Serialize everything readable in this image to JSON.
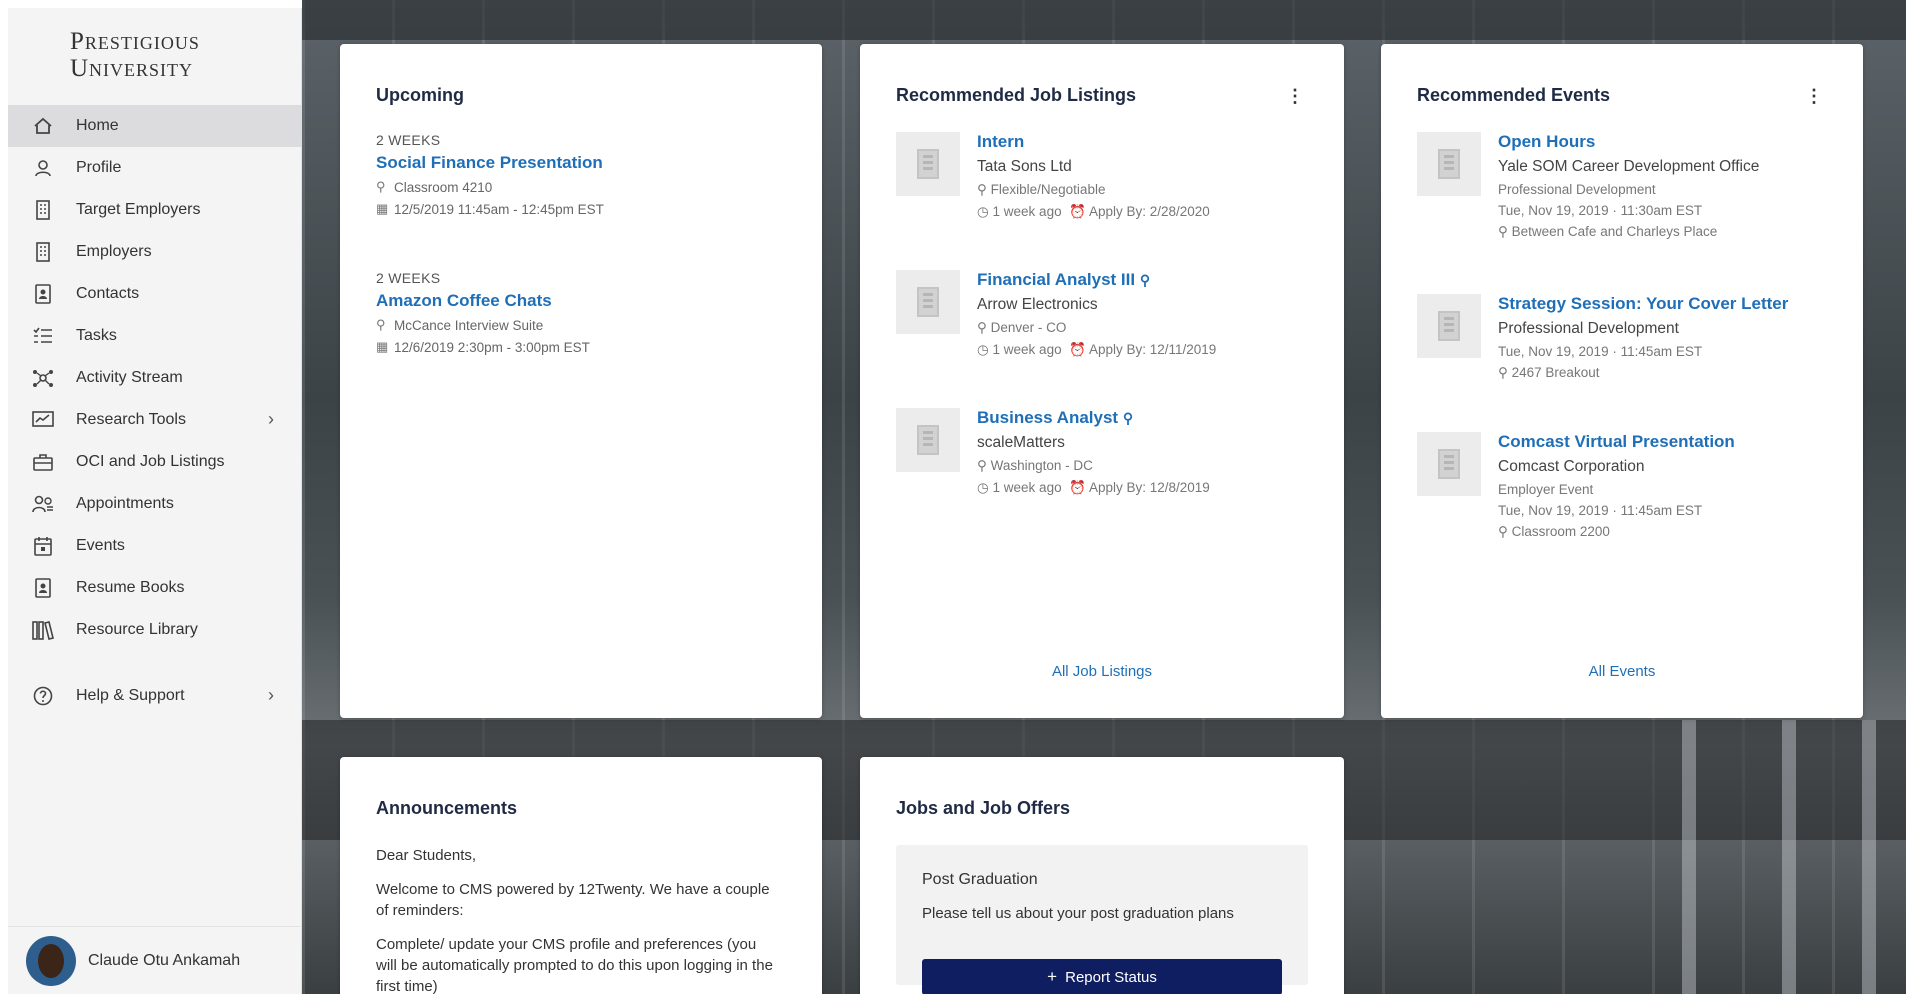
{
  "brand": {
    "logo_line1": "Prestigious",
    "logo_line2": "University"
  },
  "sidebar": {
    "items": [
      {
        "label": "Home"
      },
      {
        "label": "Profile"
      },
      {
        "label": "Target Employers"
      },
      {
        "label": "Employers"
      },
      {
        "label": "Contacts"
      },
      {
        "label": "Tasks"
      },
      {
        "label": "Activity Stream"
      },
      {
        "label": "Research Tools"
      },
      {
        "label": "OCI and Job Listings"
      },
      {
        "label": "Appointments"
      },
      {
        "label": "Events"
      },
      {
        "label": "Resume Books"
      },
      {
        "label": "Resource Library"
      },
      {
        "label": "Help & Support"
      }
    ],
    "user_name": "Claude Otu Ankamah"
  },
  "upcoming": {
    "title": "Upcoming",
    "items": [
      {
        "when": "2 WEEKS",
        "title": "Social Finance Presentation",
        "location": "Classroom 4210",
        "datetime": "12/5/2019 11:45am - 12:45pm EST"
      },
      {
        "when": "2 WEEKS",
        "title": "Amazon Coffee Chats",
        "location": "McCance Interview Suite",
        "datetime": "12/6/2019 2:30pm - 3:00pm EST"
      }
    ]
  },
  "jobs": {
    "title": "Recommended Job Listings",
    "items": [
      {
        "title": "Intern",
        "company": "Tata Sons Ltd",
        "location": "Flexible/Negotiable",
        "posted": "1 week ago",
        "apply": "Apply By: 2/28/2020"
      },
      {
        "title": "Financial Analyst III",
        "company": "Arrow Electronics",
        "location": "Denver - CO",
        "posted": "1 week ago",
        "apply": "Apply By: 12/11/2019"
      },
      {
        "title": "Business Analyst",
        "company": "scaleMatters",
        "location": "Washington - DC",
        "posted": "1 week ago",
        "apply": "Apply By: 12/8/2019"
      }
    ],
    "all_link": "All Job Listings"
  },
  "events": {
    "title": "Recommended Events",
    "items": [
      {
        "title": "Open Hours",
        "org": "Yale SOM Career Development Office",
        "type": "Professional Development",
        "datetime": "Tue, Nov 19, 2019 · 11:30am EST",
        "location": "Between Cafe and Charleys Place"
      },
      {
        "title": "Strategy Session: Your Cover Letter",
        "org": "Professional Development",
        "datetime": "Tue, Nov 19, 2019 · 11:45am EST",
        "location": "2467 Breakout"
      },
      {
        "title": "Comcast Virtual Presentation",
        "org": "Comcast Corporation",
        "type": "Employer Event",
        "datetime": "Tue, Nov 19, 2019 · 11:45am EST",
        "location": "Classroom 2200"
      }
    ],
    "all_link": "All Events"
  },
  "announcements": {
    "title": "Announcements",
    "p1": "Dear Students,",
    "p2": "Welcome to CMS powered by 12Twenty.  We have a couple of reminders:",
    "p3": "Complete/ update your CMS profile and preferences (you will be automatically prompted to do this upon logging in the first time)"
  },
  "offers": {
    "title": "Jobs and Job Offers",
    "box_title": "Post Graduation",
    "box_desc": "Please tell us about your post graduation plans",
    "button": "Report Status"
  }
}
